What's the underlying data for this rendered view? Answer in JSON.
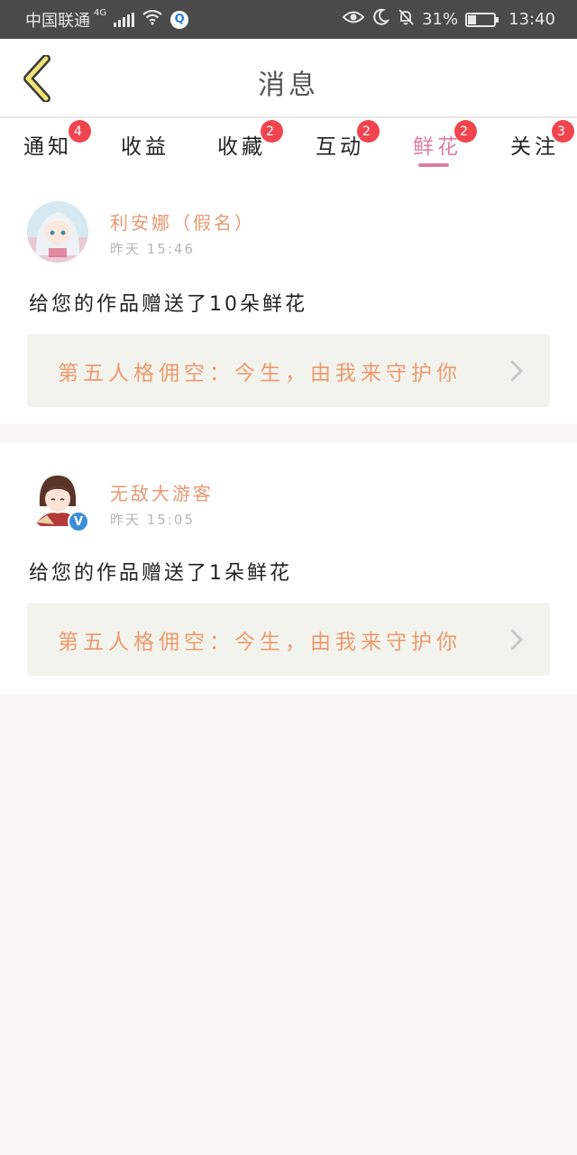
{
  "status_bar": {
    "carrier": "中国联通",
    "network": "4G",
    "battery_percent": "31%",
    "battery_level": 0.31,
    "time": "13:40",
    "icons": [
      "signal-icon",
      "wifi-icon",
      "qq-browser-icon",
      "eye-icon",
      "moon-icon",
      "mute-bell-icon",
      "battery-icon"
    ]
  },
  "header": {
    "title": "消息",
    "back_icon": "back-chevron-icon"
  },
  "tabs": [
    {
      "label": "通知",
      "badge": "4",
      "active": false
    },
    {
      "label": "收益",
      "badge": "",
      "active": false
    },
    {
      "label": "收藏",
      "badge": "2",
      "active": false
    },
    {
      "label": "互动",
      "badge": "2",
      "active": false
    },
    {
      "label": "鲜花",
      "badge": "2",
      "active": true
    },
    {
      "label": "关注",
      "badge": "3",
      "active": false
    }
  ],
  "colors": {
    "accent": "#e07aa4",
    "name": "#e89872",
    "badge": "#f0454f",
    "work_title": "#ec9a6c",
    "work_bg": "#f3f3ee"
  },
  "messages": [
    {
      "name": "利安娜（假名）",
      "time": "昨天  15:46",
      "text": "给您的作品赠送了10朵鲜花",
      "work_title": "第五人格佣空：今生，由我来守护你",
      "verified": false
    },
    {
      "name": "无敌大游客",
      "time": "昨天  15:05",
      "text": "给您的作品赠送了1朵鲜花",
      "work_title": "第五人格佣空：今生，由我来守护你",
      "verified": true
    }
  ]
}
